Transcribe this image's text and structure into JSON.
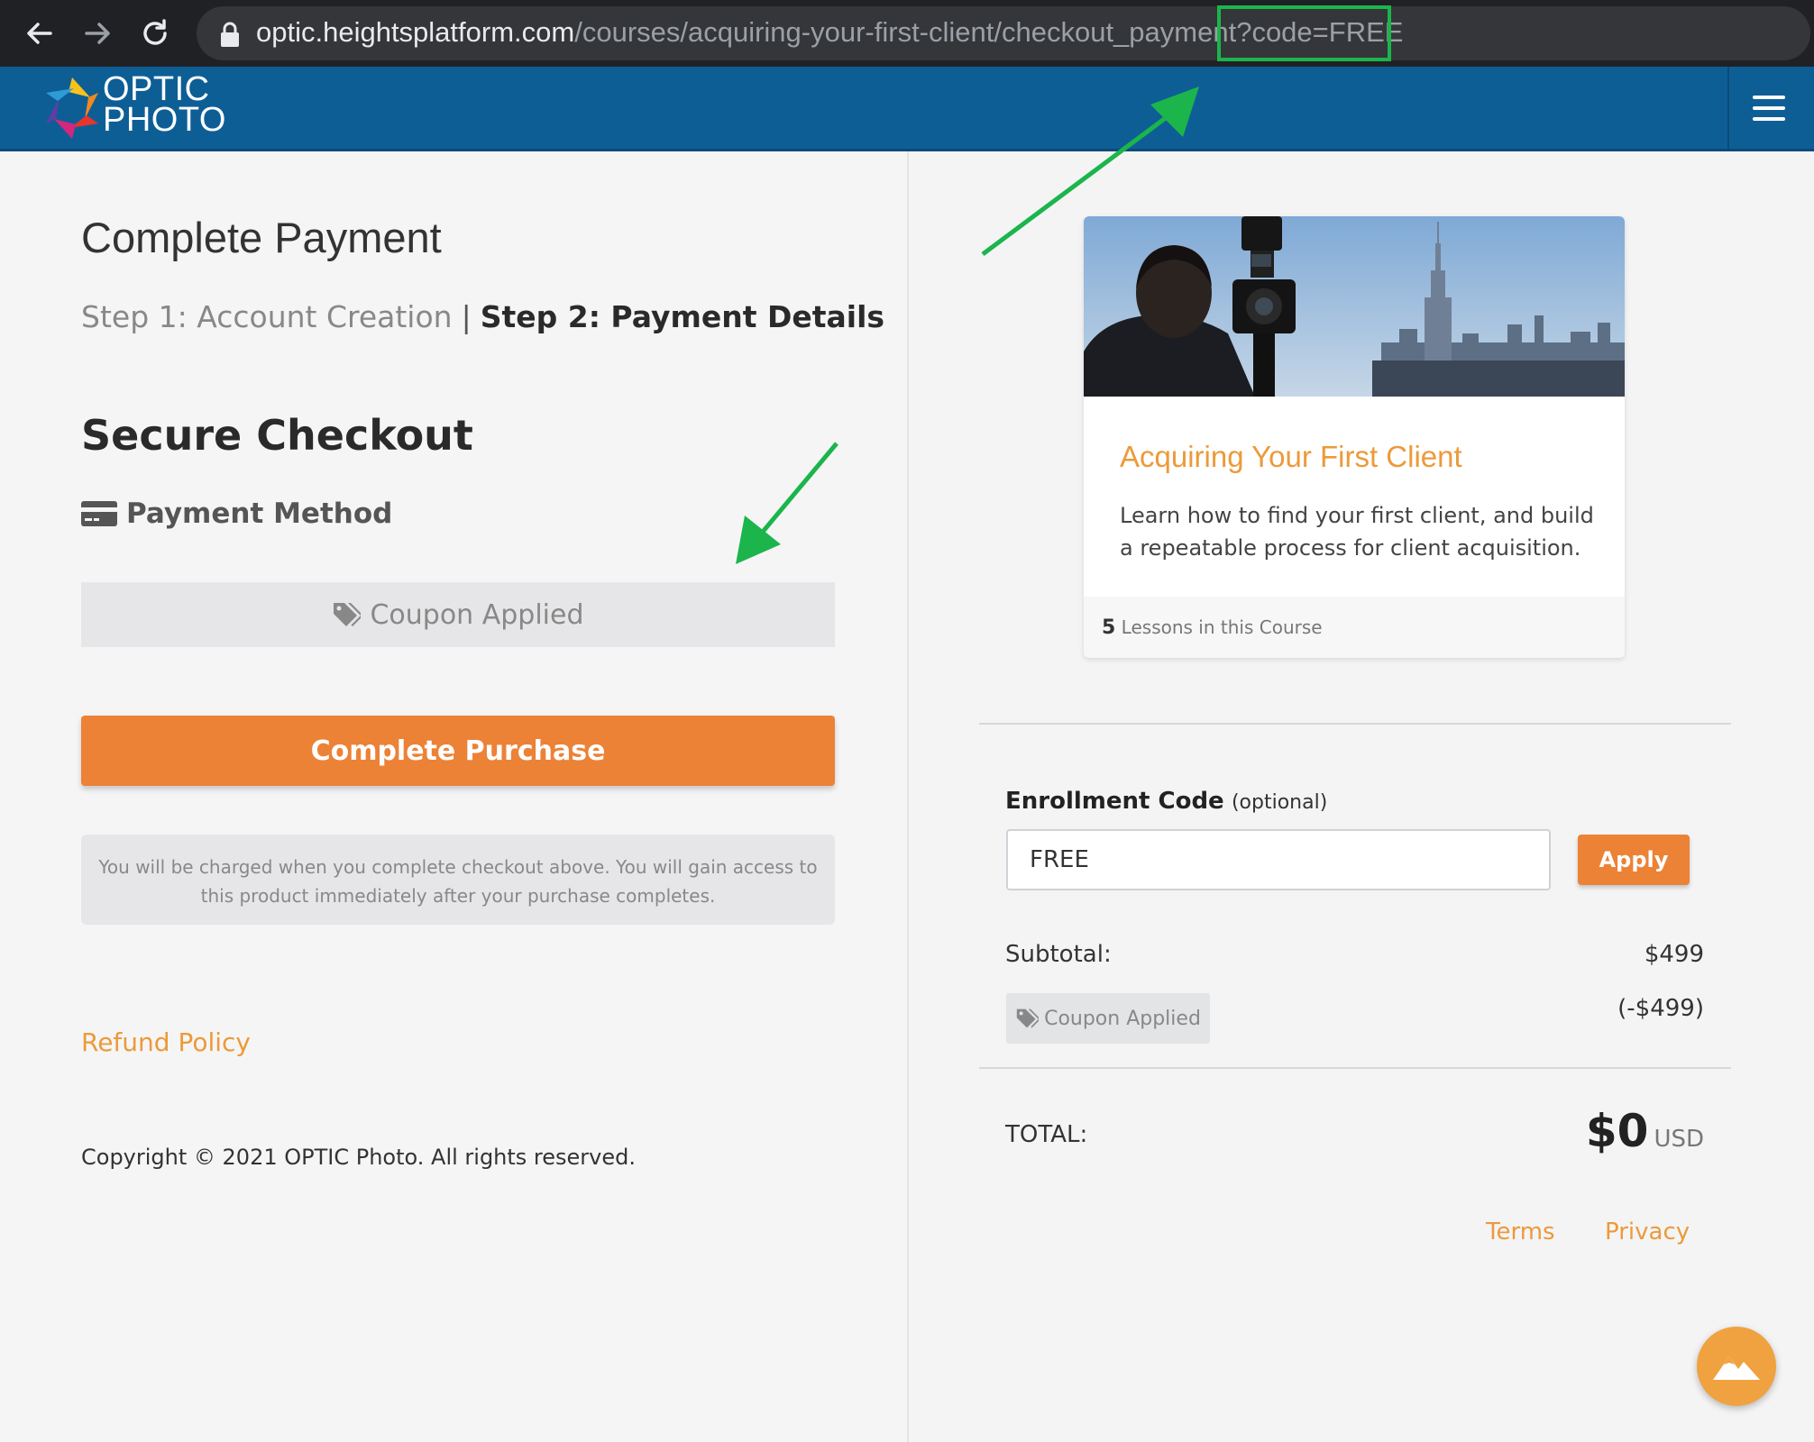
{
  "browser": {
    "url_host": "optic.heightsplatform.com",
    "url_path": "/courses/acquiring-your-first-client/checkout_payment?code=FREE",
    "icons": [
      "back-arrow-icon",
      "forward-arrow-icon",
      "reload-icon",
      "lock-icon"
    ]
  },
  "header": {
    "logo_line1": "OPTIC",
    "logo_line2": "PHOTO",
    "menu_icon": "hamburger-icon"
  },
  "checkout": {
    "title": "Complete Payment",
    "step1": "Step 1: Account Creation",
    "step_separator": "|",
    "step2": "Step 2: Payment Details",
    "secure_title": "Secure Checkout",
    "payment_method_label": "Payment Method",
    "coupon_applied": "Coupon Applied",
    "purchase_button": "Complete Purchase",
    "notice_line1": "You will be charged when you complete checkout above. You will gain access to",
    "notice_line2": "this product immediately after your purchase completes.",
    "refund_policy": "Refund Policy",
    "copyright": "Copyright © 2021 OPTIC Photo. All rights reserved."
  },
  "course": {
    "title": "Acquiring Your First Client",
    "description": "Learn how to find your first client, and build a repeatable process for client acquisition.",
    "lessons_count": "5",
    "lessons_label": "Lessons in this Course"
  },
  "order": {
    "enrollment_label": "Enrollment Code",
    "enrollment_optional": "(optional)",
    "enrollment_value": "FREE",
    "apply_button": "Apply",
    "subtotal_label": "Subtotal:",
    "subtotal_value": "$499",
    "coupon_badge": "Coupon Applied",
    "discount_value": "(-$499)",
    "total_label": "TOTAL:",
    "total_amount": "$0",
    "total_currency": "USD",
    "terms": "Terms",
    "privacy": "Privacy"
  },
  "colors": {
    "header_blue": "#0e5e96",
    "accent_orange": "#ec8236",
    "link_orange": "#ec9a3a",
    "annotation_green": "#1bb54b"
  }
}
